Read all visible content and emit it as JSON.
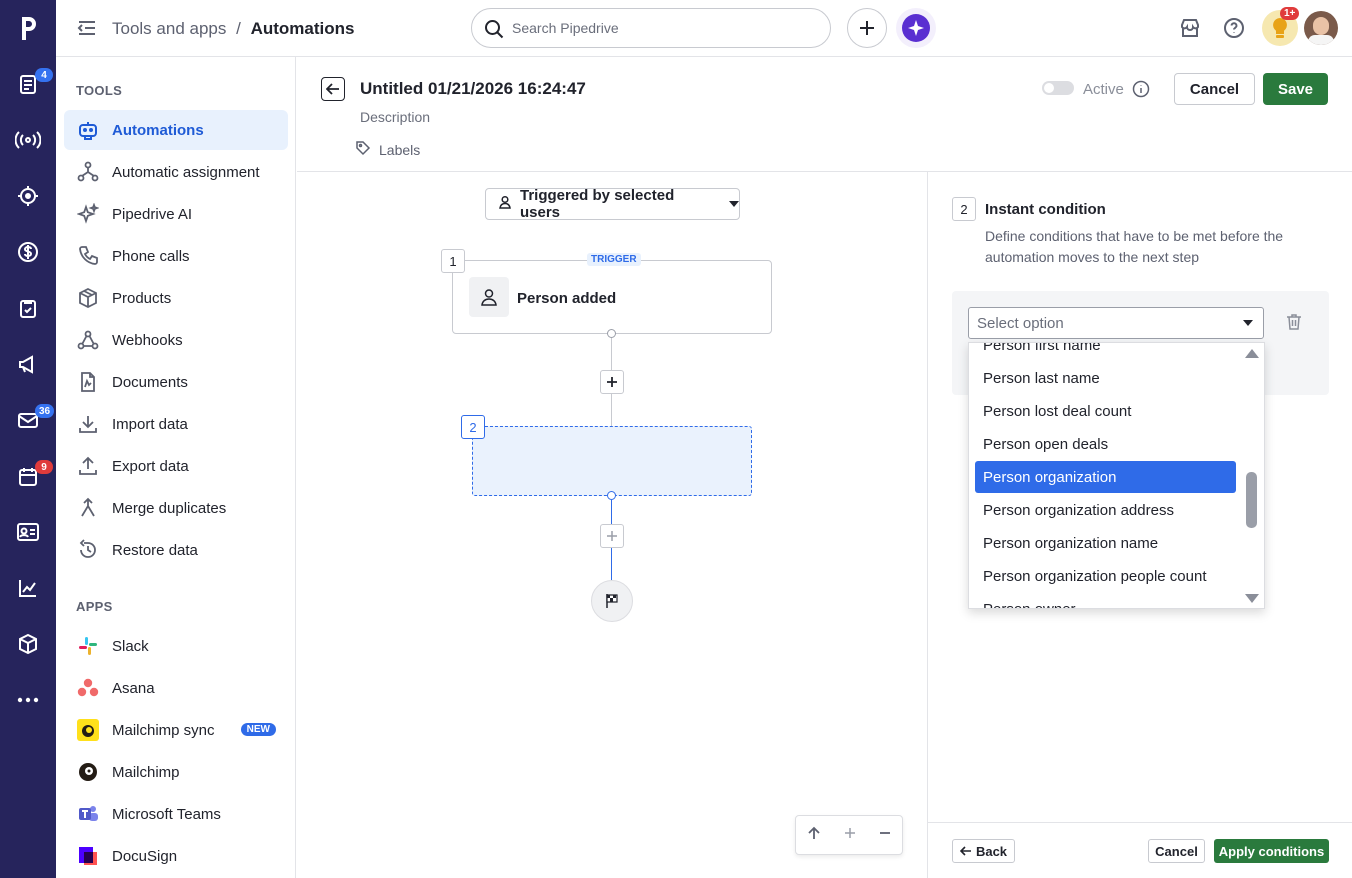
{
  "header": {
    "breadcrumb_parent": "Tools and apps",
    "breadcrumb_sep": "/",
    "breadcrumb_current": "Automations",
    "search_placeholder": "Search Pipedrive",
    "notification_badge": "1+"
  },
  "rail": {
    "badges": {
      "activities": "4",
      "mail": "36",
      "calendar": "9"
    }
  },
  "sidebar": {
    "tools_heading": "TOOLS",
    "tools": [
      {
        "label": "Automations",
        "icon": "robot-icon",
        "active": true
      },
      {
        "label": "Automatic assignment",
        "icon": "assignment-icon"
      },
      {
        "label": "Pipedrive AI",
        "icon": "sparkle-icon"
      },
      {
        "label": "Phone calls",
        "icon": "phone-icon"
      },
      {
        "label": "Products",
        "icon": "box-icon"
      },
      {
        "label": "Webhooks",
        "icon": "webhook-icon"
      },
      {
        "label": "Documents",
        "icon": "document-icon"
      },
      {
        "label": "Import data",
        "icon": "download-icon"
      },
      {
        "label": "Export data",
        "icon": "upload-icon"
      },
      {
        "label": "Merge duplicates",
        "icon": "merge-icon"
      },
      {
        "label": "Restore data",
        "icon": "restore-icon"
      }
    ],
    "apps_heading": "APPS",
    "apps": [
      {
        "label": "Slack",
        "icon": "slack-icon"
      },
      {
        "label": "Asana",
        "icon": "asana-icon"
      },
      {
        "label": "Mailchimp sync",
        "icon": "mailchimp-icon",
        "badge": "NEW"
      },
      {
        "label": "Mailchimp",
        "icon": "mailchimp-icon"
      },
      {
        "label": "Microsoft Teams",
        "icon": "teams-icon"
      },
      {
        "label": "DocuSign",
        "icon": "docusign-icon"
      }
    ]
  },
  "editor": {
    "title": "Untitled 01/21/2026 16:24:47",
    "description_placeholder": "Description",
    "labels": "Labels",
    "active_label": "Active",
    "cancel": "Cancel",
    "save": "Save"
  },
  "canvas": {
    "trigger_dropdown": "Triggered by selected users",
    "step1_num": "1",
    "trigger_tag": "TRIGGER",
    "step1_label": "Person added",
    "step2_num": "2"
  },
  "panel": {
    "step_num": "2",
    "title": "Instant condition",
    "description": "Define conditions that have to be met before the automation moves to the next step",
    "select_placeholder": "Select option",
    "options": [
      "Person first name",
      "Person last name",
      "Person lost deal count",
      "Person open deals",
      "Person organization",
      "Person organization address",
      "Person organization name",
      "Person organization people count",
      "Person owner"
    ],
    "selected_option": "Person organization",
    "back": "Back",
    "cancel": "Cancel",
    "apply": "Apply conditions"
  },
  "colors": {
    "rail_bg": "#26245c",
    "accent_blue": "#2f6be8",
    "save_green": "#2a7a3d"
  }
}
